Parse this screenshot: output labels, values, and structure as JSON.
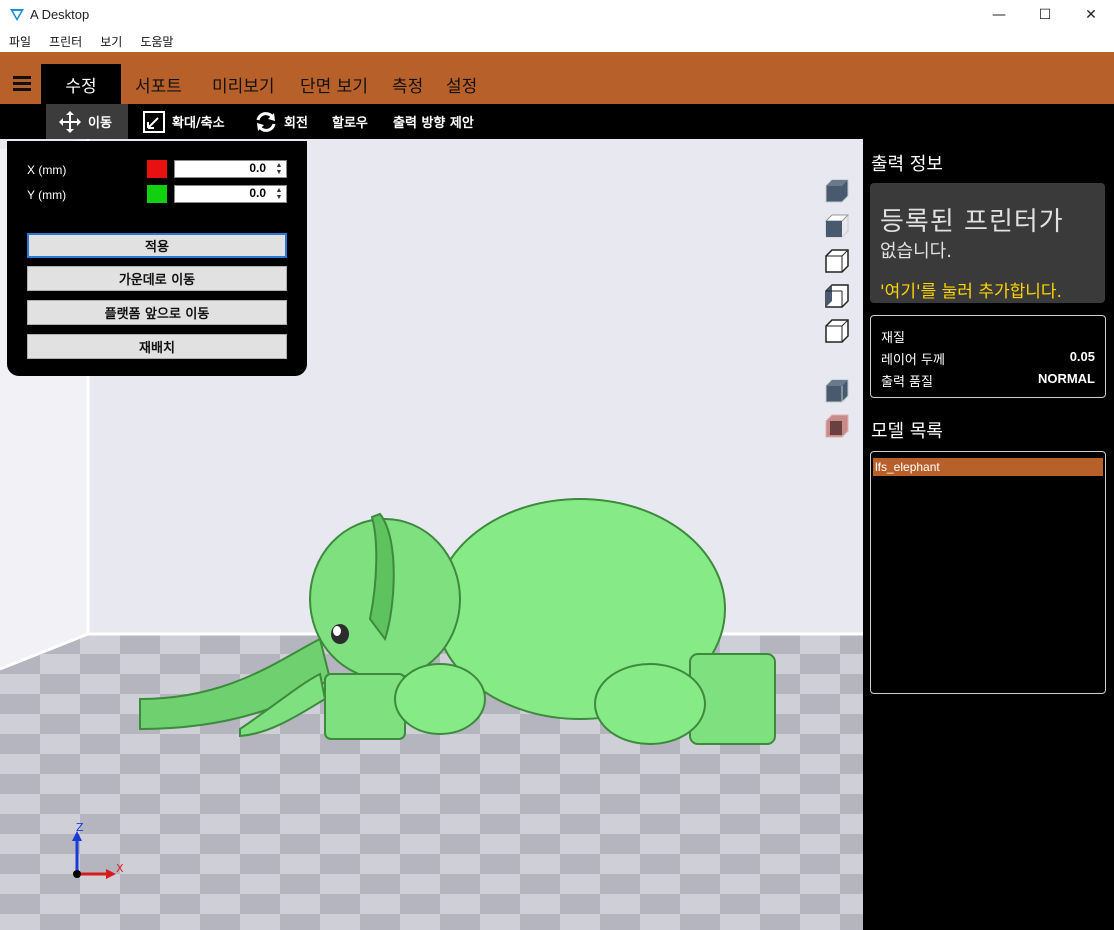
{
  "window": {
    "title": "A Desktop",
    "minimize": "—",
    "maximize": "☐",
    "close": "✕"
  },
  "menu": [
    "파일",
    "프린터",
    "보기",
    "도움말"
  ],
  "tabs": [
    {
      "label": "수정",
      "active": true
    },
    {
      "label": "서포트",
      "active": false
    },
    {
      "label": "미리보기",
      "active": false
    },
    {
      "label": "단면 보기",
      "active": false
    },
    {
      "label": "측정",
      "active": false
    },
    {
      "label": "설정",
      "active": false
    }
  ],
  "toolbar": {
    "move": "이동",
    "scale": "확대/축소",
    "rotate": "회전",
    "hollow": "할로우",
    "orientation": "출력 방향 제안"
  },
  "move_panel": {
    "x_label": "X (mm)",
    "y_label": "Y (mm)",
    "x_value": "0.0",
    "y_value": "0.0",
    "x_color": "#e81010",
    "y_color": "#10d010",
    "apply": "적용",
    "center": "가운데로 이동",
    "front": "플랫폼 앞으로 이동",
    "rearrange": "재배치"
  },
  "side": {
    "print_info_heading": "출력 정보",
    "printer_line1": "등록된 프린터가",
    "printer_line2": "없습니다.",
    "printer_link": "'여기'를 눌러 추가합니다.",
    "material_label": "재질",
    "layer_label": "레이어 두께",
    "layer_value": "0.05",
    "quality_label": "출력 품질",
    "quality_value": "NORMAL",
    "model_list_heading": "모델 목록",
    "models": [
      "lfs_elephant"
    ]
  },
  "axes": {
    "z": "Z",
    "x": "X"
  },
  "colors": {
    "accent": "#b8602a",
    "model": "#7ee07e",
    "link": "#ffd400"
  }
}
